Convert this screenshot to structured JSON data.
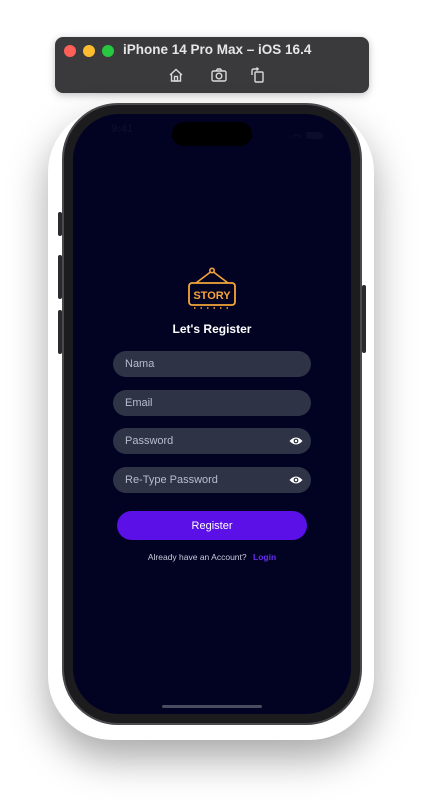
{
  "simulator": {
    "title": "iPhone 14 Pro Max – iOS 16.4",
    "toolbar": [
      "home-icon",
      "screenshot-icon",
      "rotate-icon"
    ]
  },
  "status_bar": {
    "time": "9:41"
  },
  "app": {
    "logo_text": "STORY",
    "title": "Let's Register",
    "fields": {
      "name_placeholder": "Nama",
      "email_placeholder": "Email",
      "password_placeholder": "Password",
      "retype_password_placeholder": "Re-Type Password"
    },
    "register_label": "Register",
    "account_prompt": "Already have an Account?",
    "login_label": "Login"
  },
  "colors": {
    "screen_bg": "#020323",
    "field_bg": "#2f3346",
    "accent": "#5a10e6",
    "logo": "#f5a43a",
    "link": "#6b2cf5"
  }
}
